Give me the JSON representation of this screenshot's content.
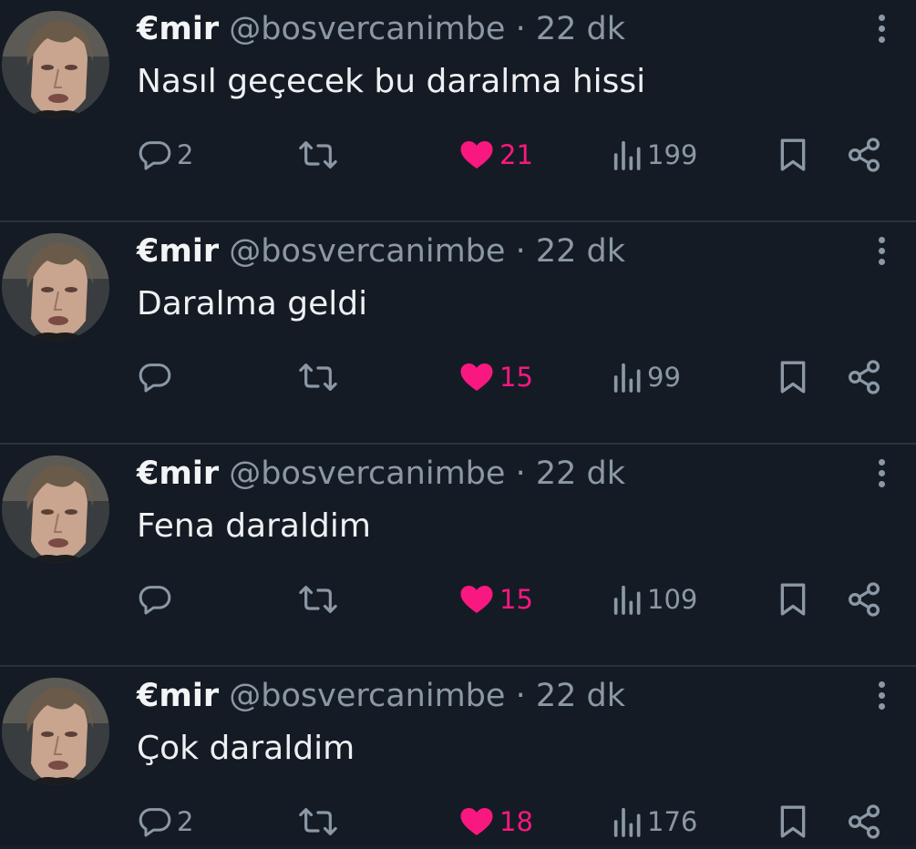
{
  "tweets": [
    {
      "author": {
        "name": "€mir",
        "handle": "@bosvercanimbe",
        "separator": "·",
        "time": "22 dk"
      },
      "text": "Nasıl geçecek bu daralma hissi",
      "stats": {
        "replies": "2",
        "likes": "21",
        "views": "199"
      }
    },
    {
      "author": {
        "name": "€mir",
        "handle": "@bosvercanimbe",
        "separator": "·",
        "time": "22 dk"
      },
      "text": "Daralma geldi",
      "stats": {
        "replies": "",
        "likes": "15",
        "views": "99"
      }
    },
    {
      "author": {
        "name": "€mir",
        "handle": "@bosvercanimbe",
        "separator": "·",
        "time": "22 dk"
      },
      "text": "Fena daraldim",
      "stats": {
        "replies": "",
        "likes": "15",
        "views": "109"
      }
    },
    {
      "author": {
        "name": "€mir",
        "handle": "@bosvercanimbe",
        "separator": "·",
        "time": "22 dk"
      },
      "text": "Çok daraldim",
      "stats": {
        "replies": "2",
        "likes": "18",
        "views": "176"
      }
    }
  ],
  "icons": {
    "reply": "reply-icon",
    "retweet": "retweet-icon",
    "like": "heart-icon",
    "views": "views-icon",
    "bookmark": "bookmark-icon",
    "share": "share-icon",
    "more": "more-icon"
  },
  "colors": {
    "background": "#151b24",
    "text": "#eef0f2",
    "muted": "#8b98a5",
    "like": "#f91880",
    "divider": "#2a323d"
  }
}
